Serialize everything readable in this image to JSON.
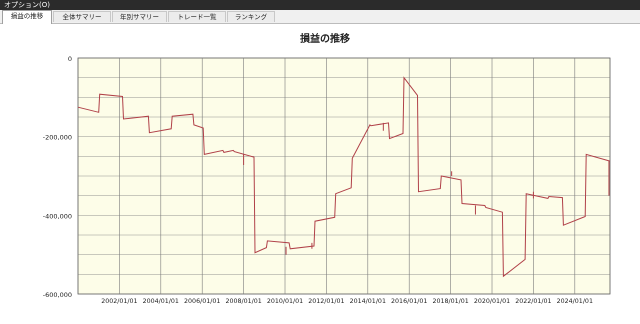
{
  "window": {
    "title": "オプション(O)"
  },
  "tabs": [
    {
      "label": "損益の推移",
      "active": true
    },
    {
      "label": "全体サマリー",
      "active": false
    },
    {
      "label": "年別サマリー",
      "active": false
    },
    {
      "label": "トレード一覧",
      "active": false
    },
    {
      "label": "ランキング",
      "active": false
    }
  ],
  "colors": {
    "plot_bg": "#fdfde8",
    "line": "#b04048",
    "grid": "#7a7a7a"
  },
  "chart_data": {
    "type": "line",
    "title": "損益の推移",
    "xlabel": "",
    "ylabel": "",
    "ylim": [
      -600000,
      0
    ],
    "yticks": [
      0,
      -200000,
      -400000,
      -600000
    ],
    "ytick_labels": [
      "0",
      "-200,000",
      "-400,000",
      "-600,000"
    ],
    "xlim": [
      2000.0,
      2025.7
    ],
    "xticks": [
      2002,
      2004,
      2006,
      2008,
      2010,
      2012,
      2014,
      2016,
      2018,
      2020,
      2022,
      2024
    ],
    "xtick_labels": [
      "2002/01/01",
      "2004/01/01",
      "2006/01/01",
      "2008/01/01",
      "2010/01/01",
      "2012/01/01",
      "2014/01/01",
      "2016/01/01",
      "2018/01/01",
      "2020/01/01",
      "2022/01/01",
      "2024/01/01"
    ],
    "grid": true,
    "series": [
      {
        "x": [
          2000.0,
          2001.0,
          2001.05,
          2002.15,
          2002.2,
          2003.4,
          2003.45,
          2004.5,
          2004.55,
          2005.55,
          2005.6,
          2006.05,
          2006.1,
          2007.0,
          2007.05,
          2007.5,
          2007.55,
          2008.5,
          2008.55,
          2009.1,
          2009.15,
          2010.2,
          2010.25,
          2011.4,
          2011.45,
          2012.4,
          2012.45,
          2013.2,
          2013.25,
          2014.1,
          2014.15,
          2015.0,
          2015.05,
          2015.7,
          2015.75,
          2016.4,
          2016.45,
          2017.5,
          2017.55,
          2018.5,
          2018.55,
          2019.65,
          2019.7,
          2020.5,
          2020.55,
          2021.6,
          2021.65,
          2022.7,
          2022.75,
          2023.4,
          2023.45,
          2024.5,
          2024.55,
          2025.7
        ],
        "y": [
          -125000,
          -138000,
          -92000,
          -98000,
          -155000,
          -148000,
          -190000,
          -180000,
          -148000,
          -143000,
          -170000,
          -178000,
          -245000,
          -235000,
          -240000,
          -235000,
          -238000,
          -252000,
          -495000,
          -482000,
          -465000,
          -470000,
          -485000,
          -478000,
          -415000,
          -405000,
          -345000,
          -330000,
          -255000,
          -170000,
          -172000,
          -165000,
          -205000,
          -192000,
          -50000,
          -95000,
          -340000,
          -332000,
          -300000,
          -310000,
          -370000,
          -375000,
          -380000,
          -392000,
          -555000,
          -512000,
          -345000,
          -357000,
          -352000,
          -355000,
          -425000,
          -403000,
          -245000,
          -262000
        ]
      }
    ],
    "spikes": [
      {
        "x": 2008.0,
        "y0": -245000,
        "y1": -272000
      },
      {
        "x": 2010.05,
        "y0": -480000,
        "y1": -500000
      },
      {
        "x": 2011.3,
        "y0": -470000,
        "y1": -485000
      },
      {
        "x": 2014.75,
        "y0": -165000,
        "y1": -185000
      },
      {
        "x": 2018.05,
        "y0": -300000,
        "y1": -288000
      },
      {
        "x": 2019.2,
        "y0": -375000,
        "y1": -398000
      },
      {
        "x": 2022.0,
        "y0": -357000,
        "y1": -340000
      },
      {
        "x": 2025.65,
        "y0": -262000,
        "y1": -350000
      }
    ]
  }
}
